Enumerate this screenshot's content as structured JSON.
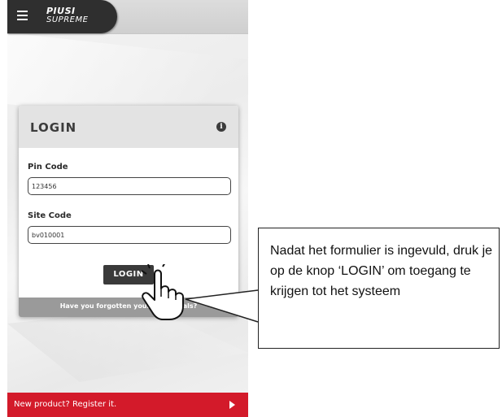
{
  "app": {
    "brand_line1": "PIUSI",
    "brand_line2": "SUPREME"
  },
  "login": {
    "title": "LOGIN",
    "info_icon": "i",
    "pin_label": "Pin Code",
    "pin_value": "123456",
    "site_label": "Site Code",
    "site_value": "bv010001",
    "button_label": "LOGIN",
    "forgot_text": "Have you forgotten your credentials?"
  },
  "register": {
    "label": "New product? Register it."
  },
  "callout": {
    "text": "Nadat het formulier is ingevuld, druk je op de knop ‘LOGIN’ om toegang te krijgen tot het systeem"
  },
  "icons": {
    "menu": "menu-icon",
    "info": "info-icon",
    "arrow": "arrow-right-icon",
    "hand": "hand-pointer-icon"
  },
  "colors": {
    "header_dark": "#2f2f2f",
    "register_red": "#d31a2a",
    "button_dark": "#3a3a3a",
    "forgot_grey": "#9a9a9a"
  }
}
